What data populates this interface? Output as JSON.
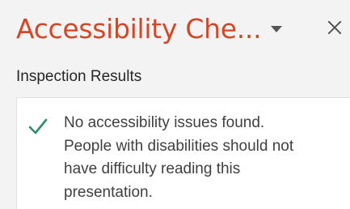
{
  "pane": {
    "title": "Accessibility Che...",
    "options_icon": "dropdown-triangle-icon",
    "close_icon": "close-x-icon",
    "accent_color": "#d24726"
  },
  "inspection": {
    "section_label": "Inspection Results",
    "result_icon": "checkmark-icon",
    "result_icon_color": "#2e8b6e",
    "result_lines": [
      "No accessibility issues found.",
      "People with disabilities should not",
      "have difficulty reading this",
      "presentation."
    ]
  }
}
